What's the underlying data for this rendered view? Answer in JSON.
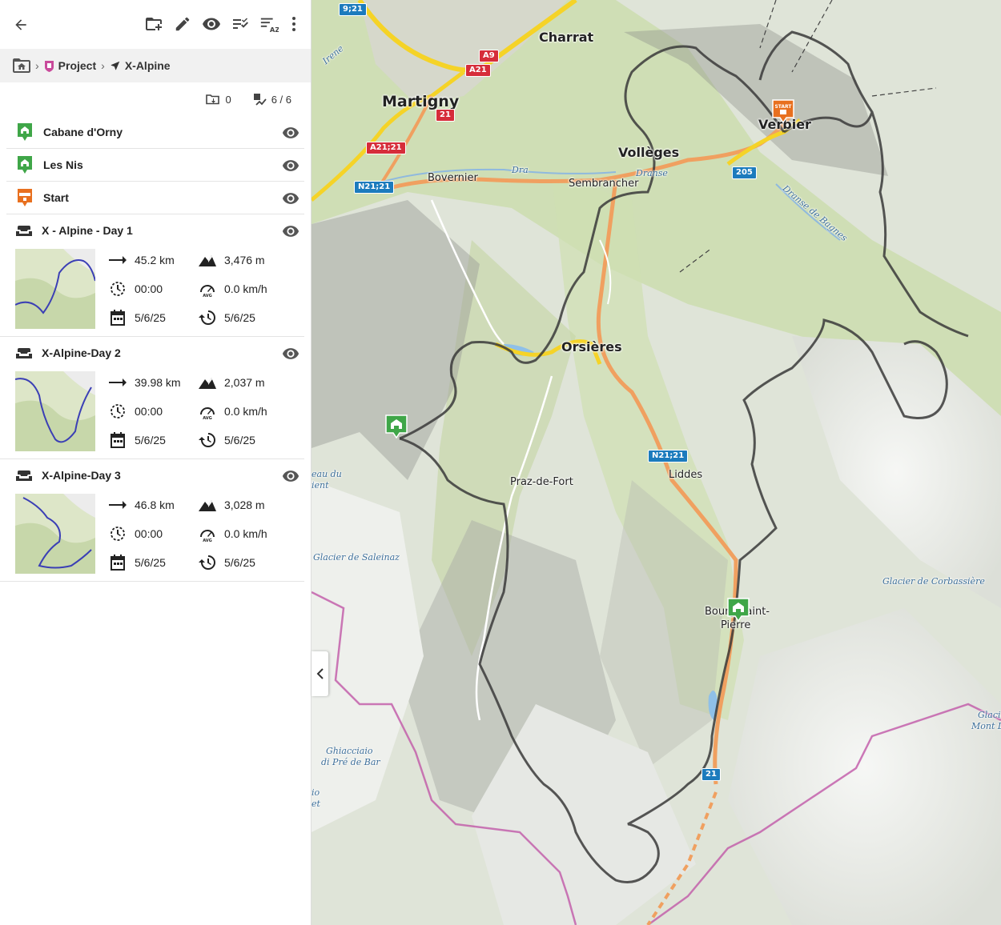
{
  "breadcrumb": {
    "project": "Project",
    "current": "X-Alpine"
  },
  "counts": {
    "folders": "0",
    "visible": "6 / 6"
  },
  "waypoints": [
    {
      "label": "Cabane d'Orny",
      "type": "hut",
      "color": "#3fa648"
    },
    {
      "label": "Les Nis",
      "type": "hut",
      "color": "#3fa648"
    },
    {
      "label": "Start",
      "type": "start",
      "color": "#e8701f"
    }
  ],
  "tracks": [
    {
      "label": "X - Alpine - Day 1",
      "distance": "45.2 km",
      "elevation": "3,476 m",
      "moving_time": "00:00",
      "avg_speed": "0.0 km/h",
      "created": "5/6/25",
      "modified": "5/6/25"
    },
    {
      "label": "X-Alpine-Day 2",
      "distance": "39.98 km",
      "elevation": "2,037 m",
      "moving_time": "00:00",
      "avg_speed": "0.0 km/h",
      "created": "5/6/25",
      "modified": "5/6/25"
    },
    {
      "label": "X-Alpine-Day 3",
      "distance": "46.8 km",
      "elevation": "3,028 m",
      "moving_time": "00:00",
      "avg_speed": "0.0 km/h",
      "created": "5/6/25",
      "modified": "5/6/25"
    }
  ],
  "map": {
    "towns": {
      "charrat": "Charrat",
      "martigny": "Martigny",
      "verbier": "Verbier",
      "volleges": "Vollèges",
      "bovernier": "Bovernier",
      "sembrancher": "Sembrancher",
      "orsieres": "Orsières",
      "praz": "Praz-de-Fort",
      "liddes": "Liddes",
      "bourg": "Bourg-Saint-",
      "bourg2": "Pierre"
    },
    "water": {
      "dranse": "Dranse",
      "dranse_bagnes": "Dranse de Bagnes",
      "dra": "Dra",
      "irene": "Irene",
      "saleinaz": "Glacier de Saleinaz",
      "corbassiere": "Glacier de Corbassière",
      "pre_de_bar_1": "Ghiacciaio",
      "pre_de_bar_2": "di Pré de Bar",
      "glaci": "Glaci",
      "mont": "Mont D",
      "eau_du": "eau du",
      "ient": "ient",
      "io": "io",
      "et": "et"
    },
    "shields": {
      "s921": "9;21",
      "a9": "A9",
      "a21": "A21",
      "r21": "21",
      "a2121": "A21;21",
      "n2121": "N21;21",
      "r205": "205",
      "n2121b": "N21;21",
      "r21b": "21"
    },
    "start_sign": "START"
  },
  "colors": {
    "track": "#3a3a3a",
    "hut": "#3fa648",
    "start": "#e8701f",
    "road_main": "#f0a060",
    "motorway": "#f5d327",
    "border": "#c158a8"
  }
}
